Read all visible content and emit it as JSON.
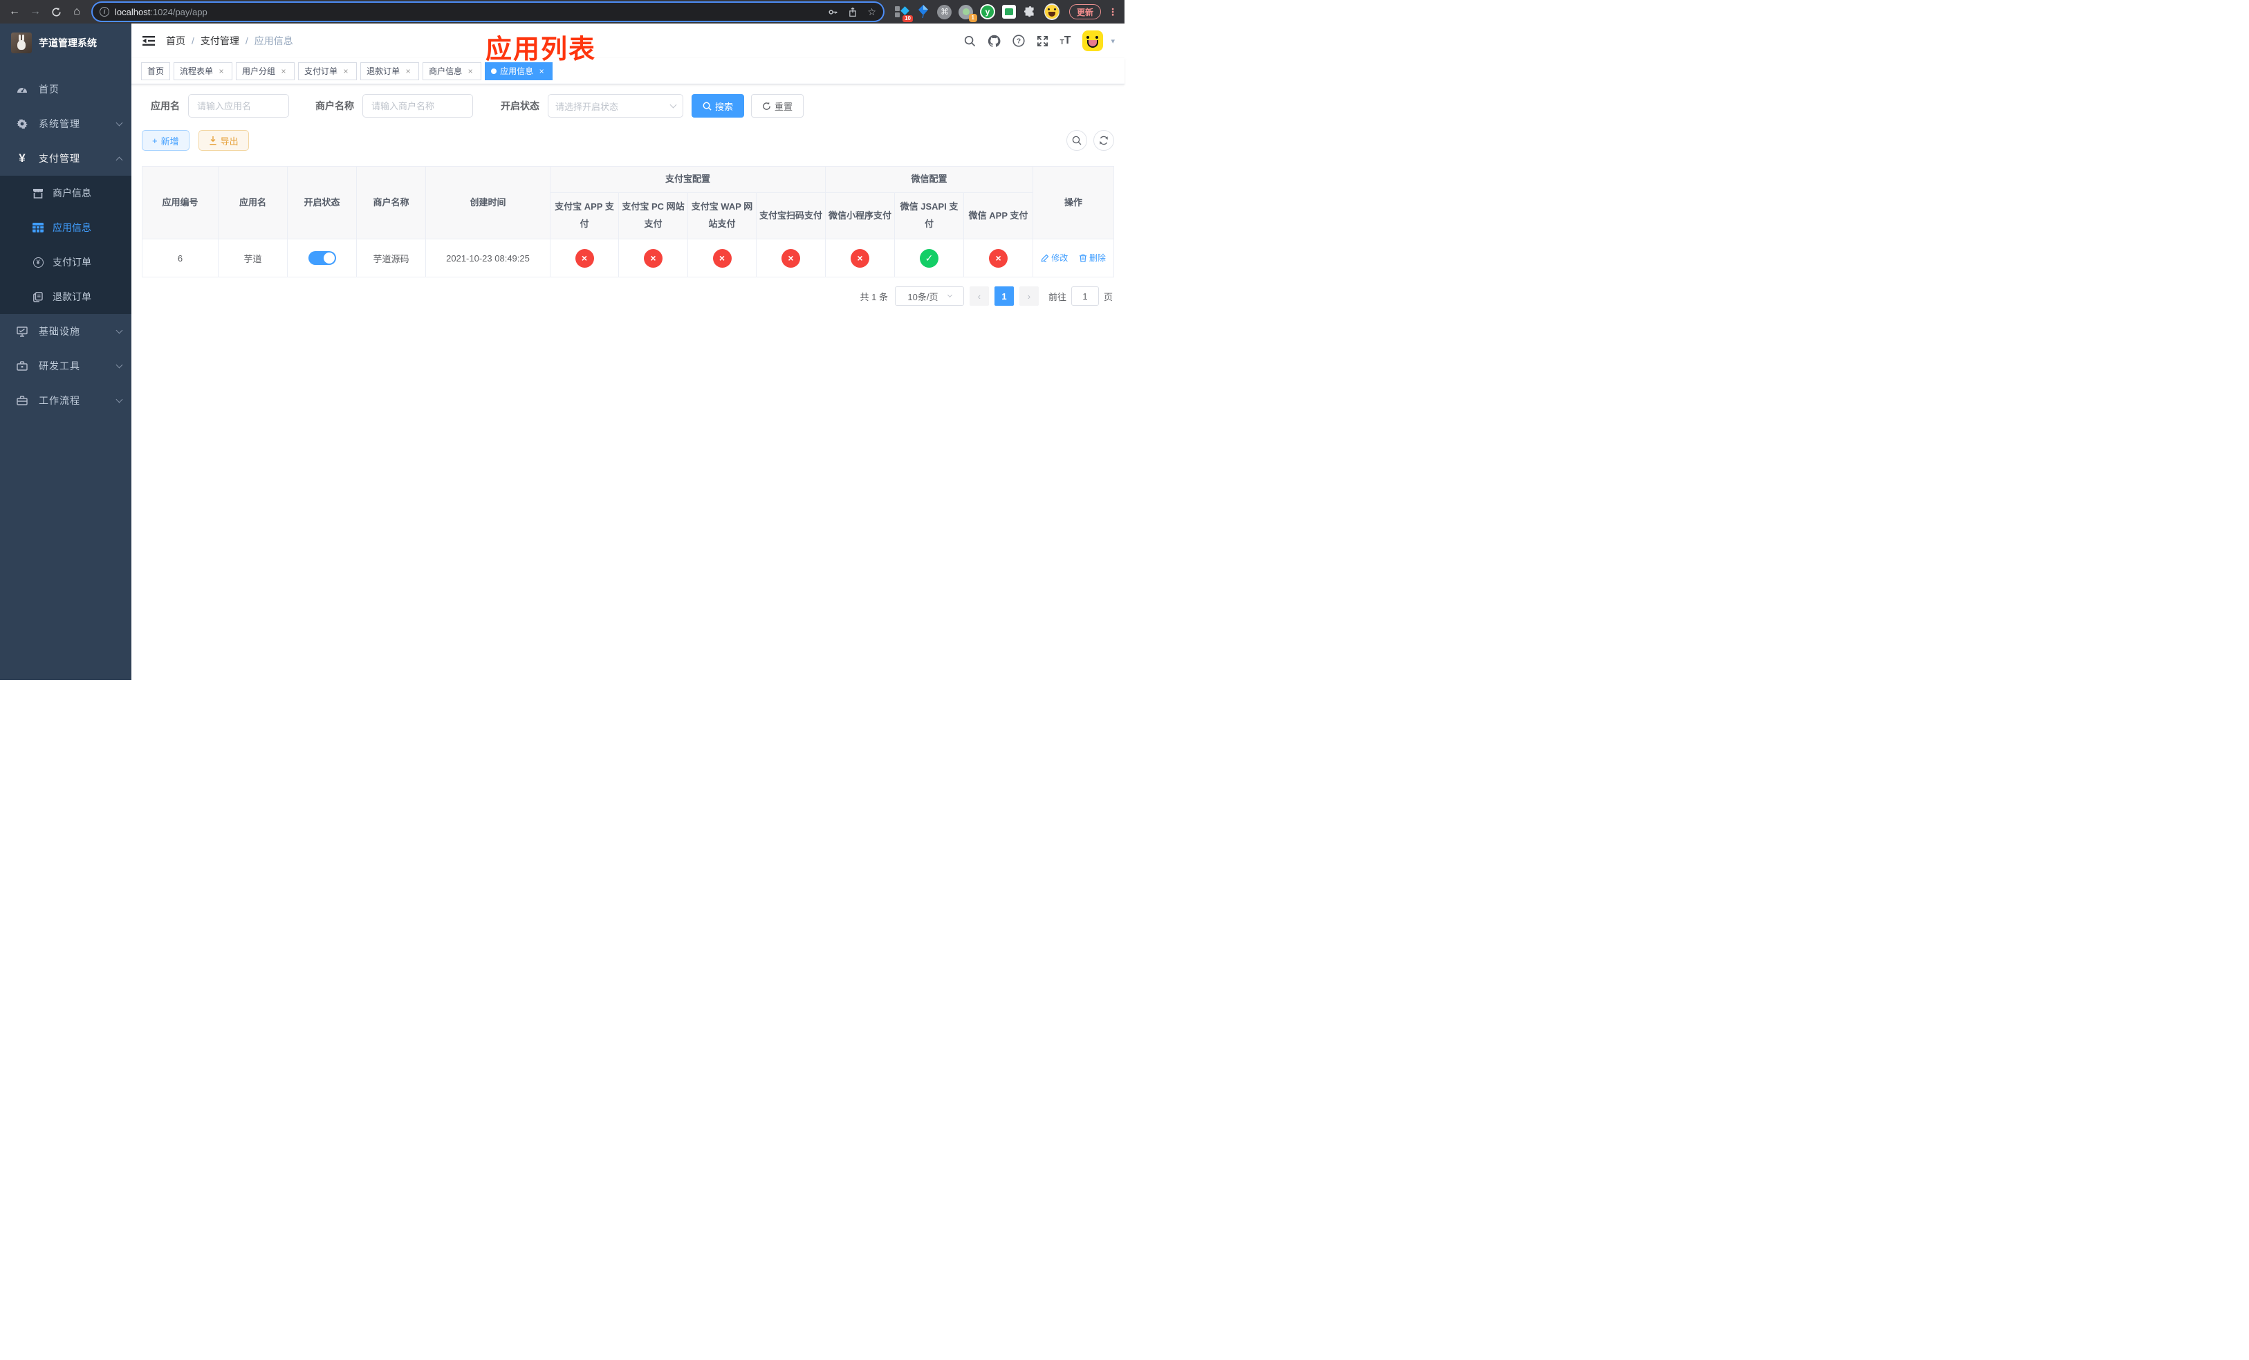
{
  "colors": {
    "accent": "#409eff",
    "danger": "#f6433c",
    "success": "#13ce66",
    "warning": "#e6a23c",
    "annotation_red": "#fe350e",
    "sidebar_bg": "#304156",
    "submenu_bg": "#1f2d3d",
    "toolbar_bg": "#35363a"
  },
  "glyphs": {
    "cross": "×",
    "check": "✓",
    "back": "←",
    "forward": "→",
    "home": "⌂",
    "star": "☆",
    "command": "⌘",
    "info": "i",
    "question": "?",
    "yen": "¥",
    "plus": "+",
    "caret": "▾",
    "dots": "⋮",
    "prev": "‹",
    "next": "›",
    "sep": "/",
    "y_logo": "y",
    "tt_small": "T",
    "tt_big": "T"
  },
  "browser": {
    "url_host": "localhost",
    "url_rest": ":1024/pay/app",
    "update_label": "更新",
    "pin_badge": "10",
    "rec_badge": "1"
  },
  "sidebar": {
    "title": "芋道管理系统",
    "menu": [
      {
        "label": "首页"
      },
      {
        "label": "系统管理"
      },
      {
        "label": "支付管理"
      },
      {
        "label": "商户信息"
      },
      {
        "label": "应用信息"
      },
      {
        "label": "支付订单"
      },
      {
        "label": "退款订单"
      },
      {
        "label": "基础设施"
      },
      {
        "label": "研发工具"
      },
      {
        "label": "工作流程"
      }
    ]
  },
  "navbar": {
    "breadcrumb": [
      "首页",
      "支付管理",
      "应用信息"
    ],
    "annotation": "应用列表"
  },
  "tabs": [
    {
      "label": "首页"
    },
    {
      "label": "流程表单"
    },
    {
      "label": "用户分组"
    },
    {
      "label": "支付订单"
    },
    {
      "label": "退款订单"
    },
    {
      "label": "商户信息"
    },
    {
      "label": "应用信息"
    }
  ],
  "filters": {
    "app_name_label": "应用名",
    "app_name_placeholder": "请输入应用名",
    "merchant_label": "商户名称",
    "merchant_placeholder": "请输入商户名称",
    "status_label": "开启状态",
    "status_placeholder": "请选择开启状态",
    "search_label": "搜索",
    "reset_label": "重置"
  },
  "toolbar": {
    "add_label": "新增",
    "export_label": "导出"
  },
  "table": {
    "columns": [
      "应用编号",
      "应用名",
      "开启状态",
      "商户名称",
      "创建时间"
    ],
    "alipay_group": "支付宝配置",
    "alipay_cols": [
      "支付宝 APP 支付",
      "支付宝 PC 网站支付",
      "支付宝 WAP 网站支付",
      "支付宝扫码支付"
    ],
    "wechat_group": "微信配置",
    "wechat_cols": [
      "微信小程序支付",
      "微信 JSAPI 支付",
      "微信 APP 支付"
    ],
    "ops_col": "操作",
    "row": {
      "id": "6",
      "name": "芋道",
      "enabled": true,
      "merchant": "芋道源码",
      "created": "2021-10-23 08:49:25",
      "channel_states": [
        "disabled",
        "disabled",
        "disabled",
        "disabled",
        "disabled",
        "enabled",
        "disabled"
      ],
      "edit_label": "修改",
      "delete_label": "删除"
    }
  },
  "pagination": {
    "total": "共 1 条",
    "page_size": "10条/页",
    "current_page": "1",
    "goto_label": "前往",
    "goto_value": "1",
    "unit_label": "页"
  }
}
